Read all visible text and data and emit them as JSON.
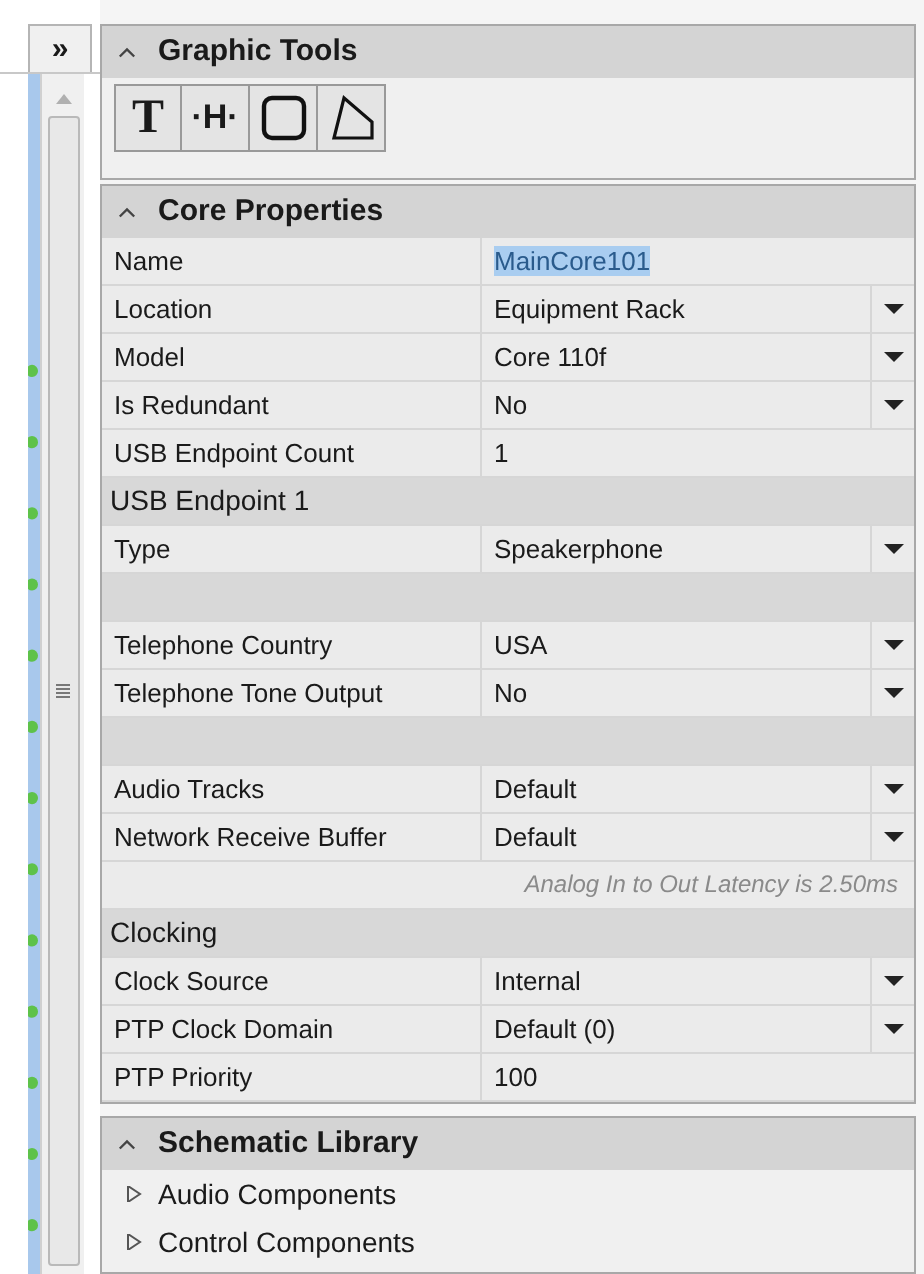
{
  "side_tab": {
    "label": "»"
  },
  "graphic_tools": {
    "title": "Graphic Tools",
    "expanded": true,
    "tools": [
      {
        "kind": "text",
        "label": "T"
      },
      {
        "kind": "line",
        "label": "·H·"
      },
      {
        "kind": "rectangle"
      },
      {
        "kind": "polygon"
      }
    ]
  },
  "core_properties": {
    "title": "Core Properties",
    "expanded": true,
    "rows": [
      {
        "kind": "property",
        "label": "Name",
        "value": "MainCore101",
        "dropdown": false,
        "selected": true
      },
      {
        "kind": "property",
        "label": "Location",
        "value": "Equipment Rack",
        "dropdown": true,
        "selected": false
      },
      {
        "kind": "property",
        "label": "Model",
        "value": "Core 110f",
        "dropdown": true,
        "selected": false
      },
      {
        "kind": "property",
        "label": "Is Redundant",
        "value": "No",
        "dropdown": true,
        "selected": false
      },
      {
        "kind": "property",
        "label": "USB Endpoint Count",
        "value": "1",
        "dropdown": false,
        "selected": false
      },
      {
        "kind": "group",
        "label": "USB Endpoint 1"
      },
      {
        "kind": "property",
        "label": "Type",
        "value": "Speakerphone",
        "dropdown": true,
        "selected": false
      },
      {
        "kind": "blank"
      },
      {
        "kind": "property",
        "label": "Telephone Country",
        "value": "USA",
        "dropdown": true,
        "selected": false
      },
      {
        "kind": "property",
        "label": "Telephone Tone Output",
        "value": "No",
        "dropdown": true,
        "selected": false
      },
      {
        "kind": "blank"
      },
      {
        "kind": "property",
        "label": "Audio Tracks",
        "value": "Default",
        "dropdown": true,
        "selected": false
      },
      {
        "kind": "property",
        "label": "Network Receive Buffer",
        "value": "Default",
        "dropdown": true,
        "selected": false
      },
      {
        "kind": "note",
        "label": "Analog In to Out Latency is 2.50ms"
      },
      {
        "kind": "group",
        "label": "Clocking"
      },
      {
        "kind": "property",
        "label": "Clock Source",
        "value": "Internal",
        "dropdown": true,
        "selected": false
      },
      {
        "kind": "property",
        "label": "PTP Clock Domain",
        "value": "Default (0)",
        "dropdown": true,
        "selected": false
      },
      {
        "kind": "property",
        "label": "PTP Priority",
        "value": "100",
        "dropdown": false,
        "selected": false
      }
    ]
  },
  "schematic_library": {
    "title": "Schematic Library",
    "expanded": true,
    "items": [
      {
        "label": "Audio Components",
        "expanded": false
      },
      {
        "label": "Control Components",
        "expanded": false
      }
    ]
  }
}
